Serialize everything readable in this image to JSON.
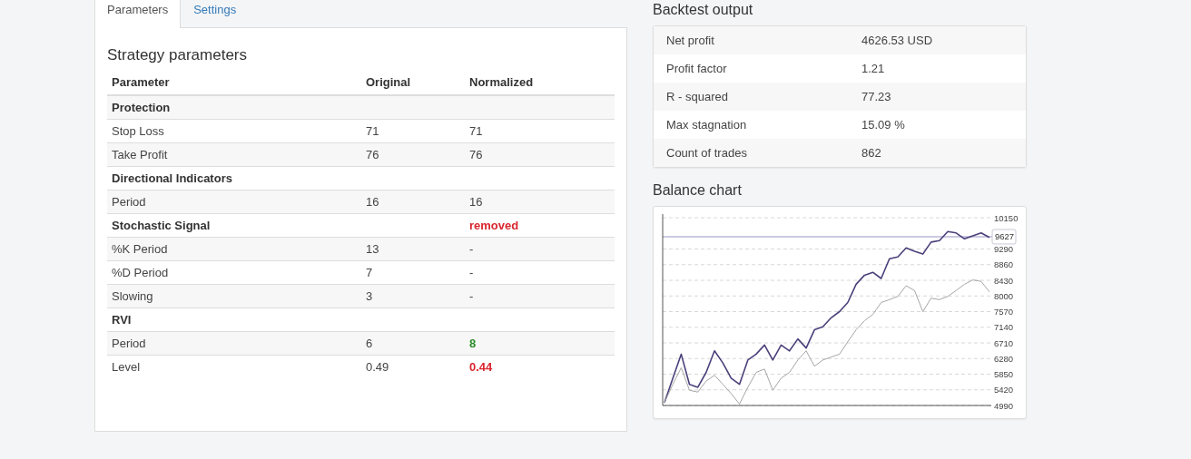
{
  "tabs": [
    {
      "label": "Parameters",
      "selected": true
    },
    {
      "label": "Settings",
      "selected": false
    }
  ],
  "strategy": {
    "title": "Strategy parameters",
    "columns": [
      "Parameter",
      "Original",
      "Normalized"
    ],
    "rows": [
      {
        "kind": "group",
        "name": "Protection"
      },
      {
        "kind": "param",
        "name": "Stop Loss",
        "original": "71",
        "normalized": "71"
      },
      {
        "kind": "param",
        "name": "Take Profit",
        "original": "76",
        "normalized": "76"
      },
      {
        "kind": "group",
        "name": "Directional Indicators"
      },
      {
        "kind": "param",
        "name": "Period",
        "original": "16",
        "normalized": "16"
      },
      {
        "kind": "group",
        "name": "Stochastic Signal",
        "normalized": "removed",
        "color": "#d9262e"
      },
      {
        "kind": "param",
        "name": "%K Period",
        "original": "13",
        "normalized": "-"
      },
      {
        "kind": "param",
        "name": "%D Period",
        "original": "7",
        "normalized": "-"
      },
      {
        "kind": "param",
        "name": "Slowing",
        "original": "3",
        "normalized": "-"
      },
      {
        "kind": "group",
        "name": "RVI"
      },
      {
        "kind": "param",
        "name": "Period",
        "original": "6",
        "normalized": "8",
        "color": "#2a8a2a"
      },
      {
        "kind": "param",
        "name": "Level",
        "original": "0.49",
        "normalized": "0.44",
        "color": "#d9262e"
      }
    ]
  },
  "backtest": {
    "title": "Backtest output",
    "rows": [
      {
        "label": "Net profit",
        "value": "4626.53 USD"
      },
      {
        "label": "Profit factor",
        "value": "1.21"
      },
      {
        "label": "R - squared",
        "value": "77.23"
      },
      {
        "label": "Max stagnation",
        "value": "15.09 %"
      },
      {
        "label": "Count of trades",
        "value": "862"
      }
    ]
  },
  "balance": {
    "title": "Balance chart",
    "chart_data": {
      "type": "line",
      "ylim": [
        4990,
        10150
      ],
      "yticks": [
        10150,
        9290,
        8860,
        8430,
        8000,
        7570,
        7140,
        6710,
        6280,
        5850,
        5420,
        4990
      ],
      "grid": true,
      "ref_lines": [
        {
          "axis": "y",
          "value": 9627,
          "label": "9627"
        }
      ],
      "series": [
        {
          "color": "#4b3f7a",
          "values": [
            5070,
            5740,
            6400,
            5570,
            5490,
            5900,
            6490,
            6160,
            5740,
            5570,
            6240,
            6400,
            6650,
            6240,
            6650,
            6490,
            6820,
            6570,
            7070,
            7150,
            7400,
            7570,
            7820,
            8320,
            8570,
            8650,
            8480,
            9020,
            9070,
            9320,
            9230,
            9150,
            9480,
            9520,
            9770,
            9730,
            9570,
            9650,
            9730,
            9610
          ]
        },
        {
          "color": "#a6a6a6",
          "values": [
            5070,
            5570,
            6030,
            5410,
            5360,
            5660,
            5820,
            5570,
            5320,
            5030,
            5490,
            5900,
            5990,
            5410,
            5740,
            5900,
            6240,
            6490,
            6070,
            6240,
            6320,
            6400,
            6740,
            7070,
            7320,
            7490,
            7820,
            7900,
            7990,
            8280,
            8150,
            7570,
            7940,
            7900,
            7990,
            8150,
            8320,
            8440,
            8400,
            8110
          ]
        }
      ]
    }
  }
}
